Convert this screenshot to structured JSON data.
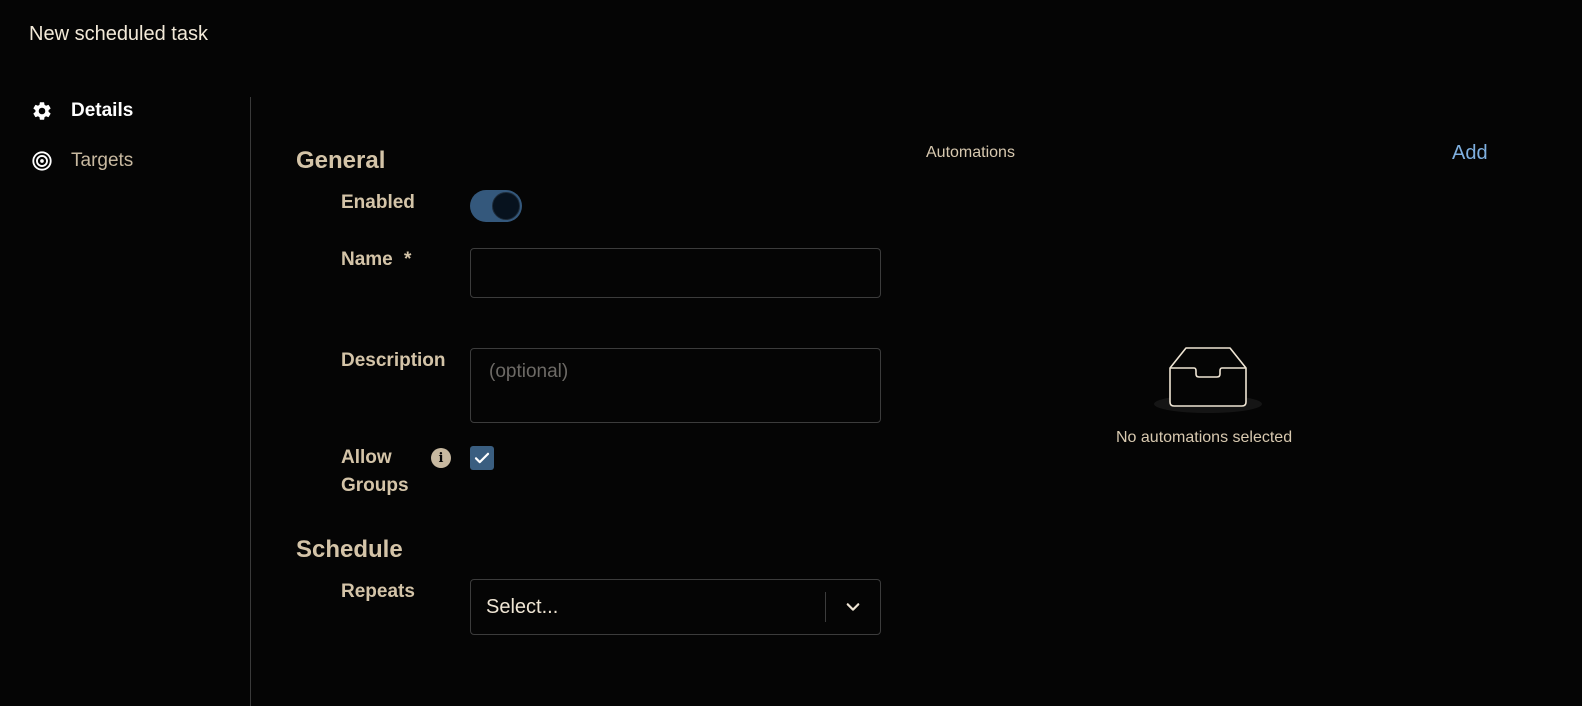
{
  "page": {
    "title": "New scheduled task"
  },
  "sidebar": {
    "items": [
      {
        "label": "Details",
        "icon": "gear-icon",
        "active": true
      },
      {
        "label": "Targets",
        "icon": "target-icon",
        "active": false
      }
    ]
  },
  "general": {
    "title": "General",
    "enabled_label": "Enabled",
    "enabled": true,
    "name_label": "Name",
    "name_required_mark": "*",
    "name_value": "",
    "description_label": "Description",
    "description_placeholder": "(optional)",
    "allow_groups_label_line1": "Allow",
    "allow_groups_label_line2": "Groups",
    "allow_groups_checked": true
  },
  "schedule": {
    "title": "Schedule",
    "repeats_label": "Repeats",
    "repeats_value": "Select..."
  },
  "automations": {
    "label": "Automations",
    "add_label": "Add",
    "empty_text": "No automations selected"
  },
  "colors": {
    "background": "#050505",
    "accent": "#34587c",
    "link": "#7fb0e0",
    "label": "#d4c4a8"
  }
}
